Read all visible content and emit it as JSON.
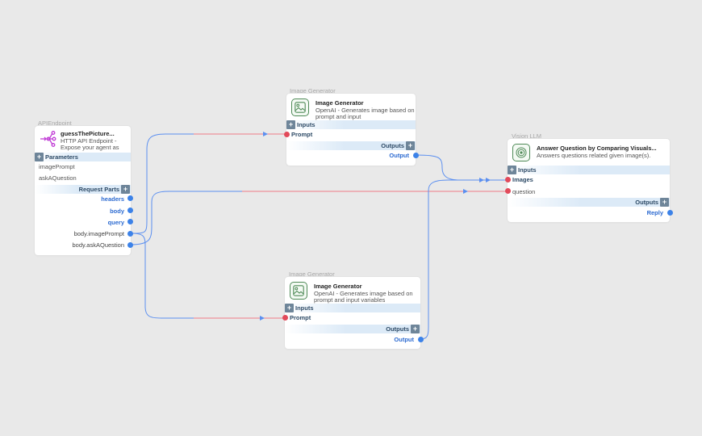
{
  "api_node": {
    "caption": "APIEndpoint",
    "title": "guessThePicture...",
    "desc": "HTTP API Endpoint - Expose your agent as",
    "parameters_label": "Parameters",
    "params": [
      "imagePrompt",
      "askAQuestion"
    ],
    "request_parts_label": "Request Parts",
    "outputs": [
      "headers",
      "body",
      "query"
    ],
    "body_outputs": [
      "body.imagePrompt",
      "body.askAQuestion"
    ]
  },
  "image_gen_top": {
    "caption": "Image Generator",
    "title": "Image Generator",
    "desc": "OpenAI - Generates image based on prompt and input",
    "inputs_label": "Inputs",
    "input_port": "Prompt",
    "outputs_label": "Outputs",
    "output_port": "Output"
  },
  "image_gen_bottom": {
    "caption": "Image Generator",
    "title": "Image Generator",
    "desc": "OpenAI - Generates image based on prompt and input variables",
    "inputs_label": "Inputs",
    "input_port": "Prompt",
    "outputs_label": "Outputs",
    "output_port": "Output"
  },
  "vision_node": {
    "caption": "Vision LLM",
    "title": "Answer Question by Comparing Visuals...",
    "desc": "Answers questions related given image(s).",
    "inputs_label": "Inputs",
    "input_ports": [
      "Images",
      "question"
    ],
    "outputs_label": "Outputs",
    "output_port": "Reply"
  },
  "icons": {
    "api": "api-endpoint-icon",
    "image": "image-icon",
    "vision": "vision-target-icon",
    "add": "plus-icon"
  },
  "colors": {
    "edge_blue": "#5b8ff0",
    "edge_red": "#ef7b86",
    "port_red": "#e24a5a",
    "port_blue": "#3c82e8",
    "icon_green": "#4f8a57",
    "api_purple": "#c13ed6"
  }
}
